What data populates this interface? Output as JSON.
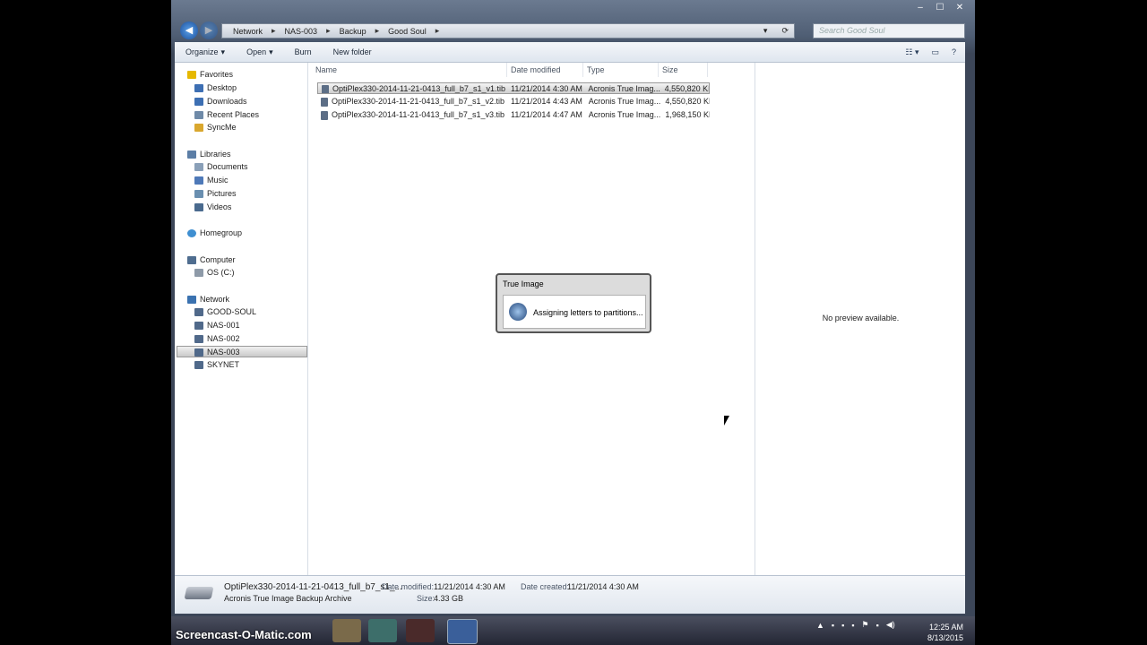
{
  "window": {
    "controls": [
      "–",
      "☐",
      "✕"
    ]
  },
  "address": {
    "back_icon": "back-arrow-icon",
    "forward_icon": "forward-arrow-icon",
    "crumbs": [
      "Network",
      "NAS-003",
      "Backup",
      "Good Soul"
    ],
    "search_placeholder": "Search Good Soul"
  },
  "toolbar": {
    "organize": "Organize",
    "open": "Open",
    "burn": "Burn",
    "new_folder": "New folder"
  },
  "nav": {
    "favorites": "Favorites",
    "desktop": "Desktop",
    "downloads": "Downloads",
    "recent": "Recent Places",
    "syncme": "SyncMe",
    "libraries": "Libraries",
    "documents": "Documents",
    "music": "Music",
    "pictures": "Pictures",
    "videos": "Videos",
    "homegroup": "Homegroup",
    "computer": "Computer",
    "os": "OS (C:)",
    "network": "Network",
    "good_soul": "GOOD-SOUL",
    "nas1": "NAS-001",
    "nas2": "NAS-002",
    "nas3": "NAS-003",
    "skynet": "SKYNET"
  },
  "columns": {
    "name": "Name",
    "date": "Date modified",
    "type": "Type",
    "size": "Size"
  },
  "files": [
    {
      "name": "OptiPlex330-2014-11-21-0413_full_b7_s1_v1.tib",
      "date": "11/21/2014 4:30 AM",
      "type": "Acronis True Imag...",
      "size": "4,550,820 KB"
    },
    {
      "name": "OptiPlex330-2014-11-21-0413_full_b7_s1_v2.tib",
      "date": "11/21/2014 4:43 AM",
      "type": "Acronis True Imag...",
      "size": "4,550,820 KB"
    },
    {
      "name": "OptiPlex330-2014-11-21-0413_full_b7_s1_v3.tib",
      "date": "11/21/2014 4:47 AM",
      "type": "Acronis True Imag...",
      "size": "1,968,150 KB"
    }
  ],
  "preview": {
    "text": "No preview available."
  },
  "details": {
    "filename": "OptiPlex330-2014-11-21-0413_full_b7_s1_...",
    "filetype": "Acronis True Image Backup Archive",
    "date_modified_label": "Date modified:",
    "date_modified": "11/21/2014 4:30 AM",
    "size_label": "Size:",
    "size": "4.33 GB",
    "date_created_label": "Date created:",
    "date_created": "11/21/2014 4:30 AM"
  },
  "dialog": {
    "title": "True Image",
    "message": "Assigning letters to partitions..."
  },
  "taskbar": {
    "watermark": "Screencast-O-Matic.com",
    "time": "12:25 AM",
    "date": "8/13/2015"
  }
}
